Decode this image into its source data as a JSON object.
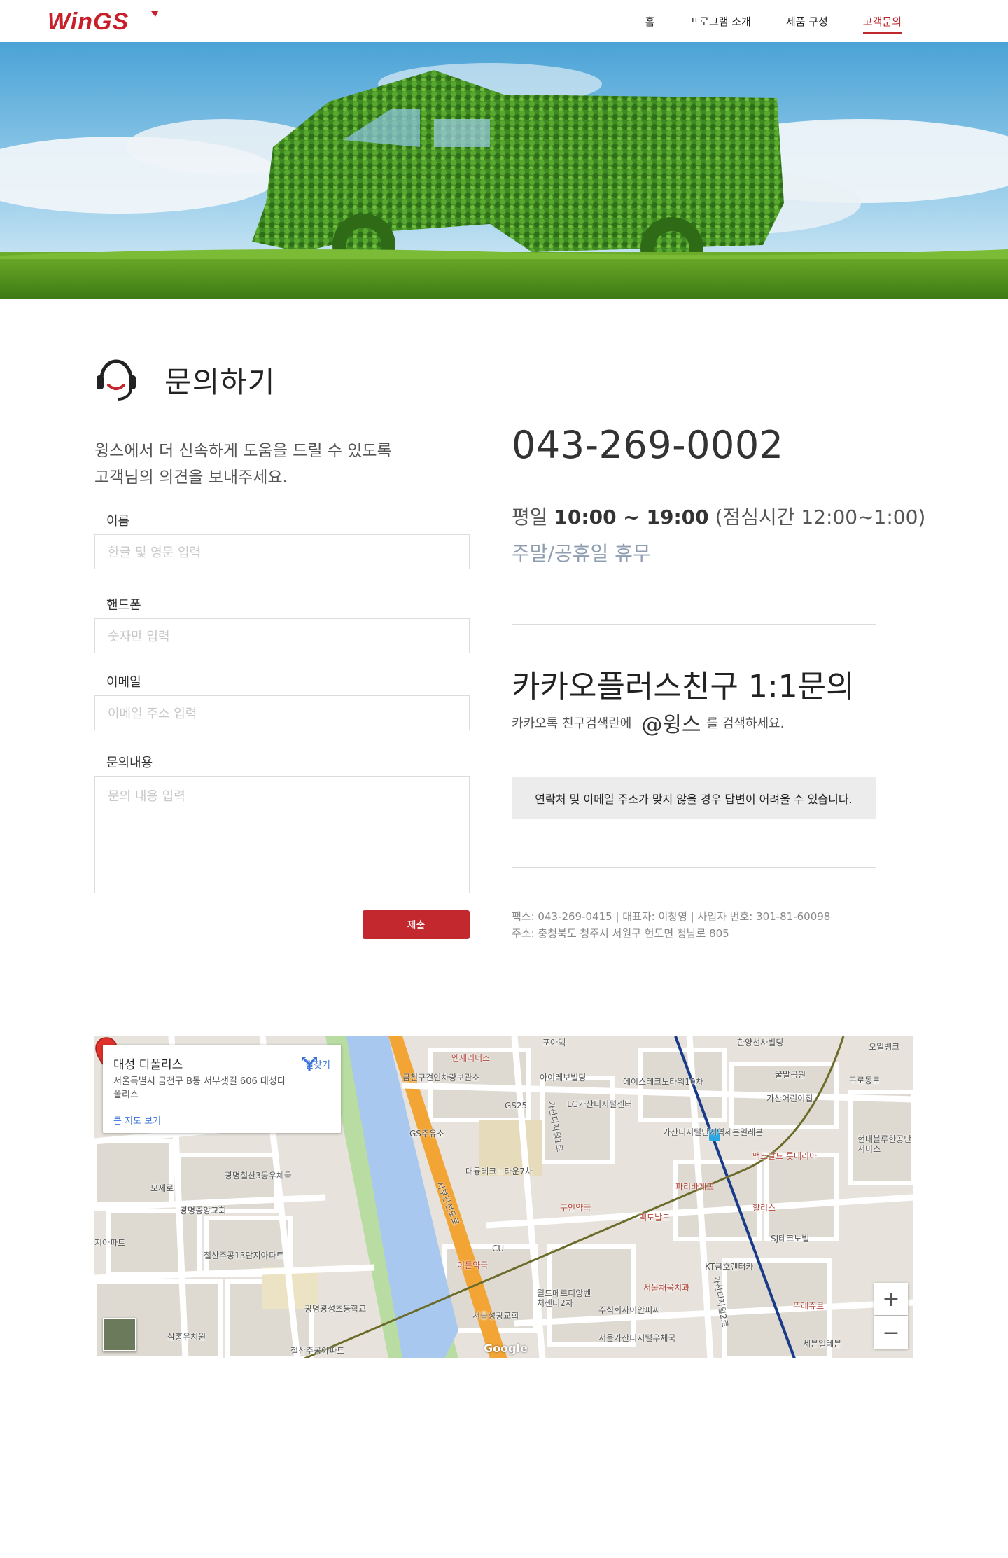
{
  "header": {
    "logo_text": "WinGS",
    "nav": [
      {
        "label": "홈",
        "active": false
      },
      {
        "label": "프로그램 소개",
        "active": false
      },
      {
        "label": "제품 구성",
        "active": false
      },
      {
        "label": "고객문의",
        "active": true
      }
    ]
  },
  "section": {
    "icon": "headset-icon",
    "title": "문의하기"
  },
  "form": {
    "intro_line1": "윙스에서 더 신속하게 도움을 드릴 수 있도록",
    "intro_line2": "고객님의 의견을 보내주세요.",
    "name_label": "이름",
    "name_placeholder": "한글 및 영문 입력",
    "phone_label": "핸드폰",
    "phone_placeholder": "숫자만 입력",
    "email_label": "이메일",
    "email_placeholder": "이메일 주소 입력",
    "message_label": "문의내용",
    "message_placeholder": "문의 내용 입력",
    "submit_label": "제출"
  },
  "contact": {
    "phone": "043-269-0002",
    "hours_prefix": "평일 ",
    "hours_time": "10:00 ~ 19:00",
    "hours_suffix": " (점심시간 12:00~1:00)",
    "closed": "주말/공휴일 휴무",
    "kakao_title": "카카오플러스친구 1:1문의",
    "kakao_desc_prefix": "카카오톡 친구검색란에",
    "kakao_handle": "@윙스",
    "kakao_desc_suffix": "를 검색하세요.",
    "notice": "연락처 및 이메일 주소가 맞지 않을 경우 답변이 어려울 수 있습니다.",
    "footer_line1": "팩스: 043-269-0415  |  대표자: 이창영  |  사업자 번호: 301-81-60098",
    "footer_line2": "주소: 충청북도 청주시 서원구 현도면 청남로 805"
  },
  "map": {
    "place_name": "대성 디폴리스",
    "address": "서울특별시 금천구 B동 서부샛길 606 대성디폴리스",
    "large_map_link": "큰 지도 보기",
    "route_label": "길찾기",
    "zoom_in": "+",
    "zoom_out": "−",
    "brand": "Google",
    "labels": [
      {
        "text": "포아텍",
        "red": false
      },
      {
        "text": "엔제리너스",
        "red": true
      },
      {
        "text": "금천구견인차량보관소",
        "red": false
      },
      {
        "text": "아이레보빌딩",
        "red": false
      },
      {
        "text": "에이스테크노타워10차",
        "red": false
      },
      {
        "text": "LG가산디지털센터",
        "red": false
      },
      {
        "text": "GS25",
        "red": false
      },
      {
        "text": "GS주유소",
        "red": false
      },
      {
        "text": "가산디지털1로",
        "red": false
      },
      {
        "text": "대륭테크노타운7차",
        "red": false
      },
      {
        "text": "구인약국",
        "red": true
      },
      {
        "text": "가산디지털단지역",
        "red": false
      },
      {
        "text": "세븐일레븐",
        "red": false
      },
      {
        "text": "맥도날드 롯데리아",
        "red": true
      },
      {
        "text": "파리바게뜨",
        "red": true
      },
      {
        "text": "할리스",
        "red": true
      },
      {
        "text": "맥도날드",
        "red": true
      },
      {
        "text": "CU",
        "red": false
      },
      {
        "text": "이든약국",
        "red": true
      },
      {
        "text": "서부간선도로",
        "red": false
      },
      {
        "text": "광명철산3동우체국",
        "red": false
      },
      {
        "text": "광명중앙교회",
        "red": false
      },
      {
        "text": "철산주공13단지아파트",
        "red": false
      },
      {
        "text": "모세로",
        "red": false
      },
      {
        "text": "광명광성초등학교",
        "red": false
      },
      {
        "text": "삼홍유치원",
        "red": false
      },
      {
        "text": "철산주공아파트",
        "red": false
      },
      {
        "text": "지아파트",
        "red": false
      },
      {
        "text": "월드메르디앙벤처센터2차",
        "red": false
      },
      {
        "text": "서울성광교회",
        "red": false
      },
      {
        "text": "주식회사이안피씨",
        "red": false
      },
      {
        "text": "서울가산디지털우체국",
        "red": false
      },
      {
        "text": "서울채움치과",
        "red": true
      },
      {
        "text": "KT금호렌터카",
        "red": false
      },
      {
        "text": "SJ테크노빌",
        "red": false
      },
      {
        "text": "뚜레쥬르",
        "red": true
      },
      {
        "text": "세븐일레븐",
        "red": false
      },
      {
        "text": "한양선사빌딩",
        "red": false
      },
      {
        "text": "오일뱅크",
        "red": false
      },
      {
        "text": "꿀말공원",
        "red": false
      },
      {
        "text": "구로동로",
        "red": false
      },
      {
        "text": "가산어린이집",
        "red": false
      },
      {
        "text": "현대블루한공단서비스",
        "red": false
      },
      {
        "text": "가산디지털2로",
        "red": false
      }
    ]
  }
}
